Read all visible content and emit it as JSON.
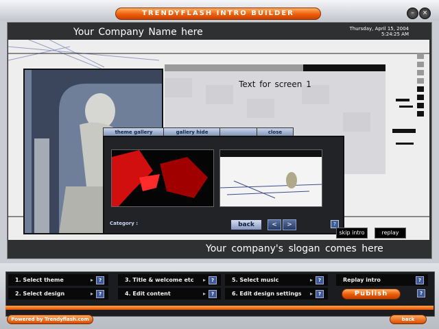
{
  "app": {
    "title": "TRENDYFLASH INTRO BUILDER"
  },
  "header": {
    "company": "Your Company Name here",
    "date": "Thursday, April 15, 2004",
    "time": "5:24:25 AM"
  },
  "screen": {
    "text": "Text for screen 1"
  },
  "gallery": {
    "tabs": [
      "theme gallery",
      "gallery hide",
      "close"
    ],
    "category_label": "Category :",
    "back_label": "back",
    "prev": "<",
    "next": ">",
    "help": "?"
  },
  "intro_controls": {
    "skip": "skip intro",
    "replay": "replay"
  },
  "footer": {
    "slogan": "Your company's slogan comes here"
  },
  "menu": {
    "items": [
      "1. Select theme",
      "2. Select design",
      "3. Title & welcome etc",
      "4. Edit content",
      "5. Select music",
      "6. Edit design settings",
      "Replay intro"
    ],
    "publish": "Publish",
    "help": "?"
  },
  "bottom": {
    "powered": "Powered by Trendyflash.com",
    "back": "back"
  },
  "colors": {
    "accent": "#ee5f0a",
    "panel": "#1b1c1f",
    "gallery_button": "#8496bf"
  }
}
